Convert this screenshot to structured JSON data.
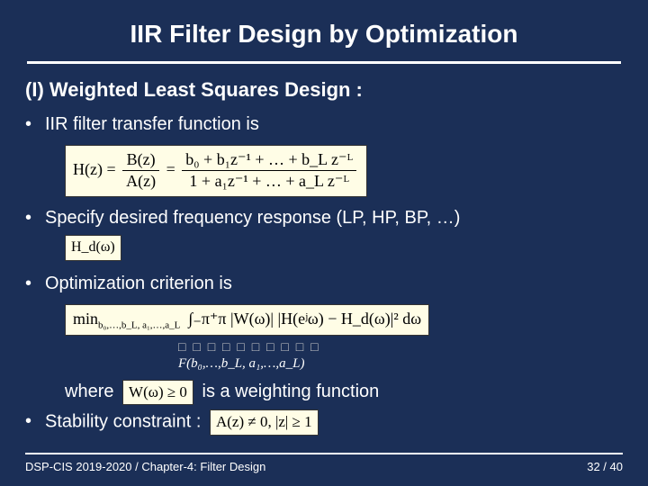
{
  "slide": {
    "title": "IIR Filter Design by Optimization",
    "subtitle": "(I)  Weighted Least Squares Design :",
    "bullets": {
      "b1": "IIR filter transfer function is",
      "b2": "Specify desired frequency response (LP, HP, BP, …)",
      "b3": "Optimization criterion is",
      "b4": "Stability constraint  :"
    },
    "formulas": {
      "hz_lhs": "H(z) =",
      "hz_frac1_num": "B(z)",
      "hz_frac1_den": "A(z)",
      "hz_eq": " = ",
      "hz_frac2_num": "b₀ + b₁z⁻¹ + … + b_L z⁻ᴸ",
      "hz_frac2_den": "1 + a₁z⁻¹ + … + a_L z⁻ᴸ",
      "hd": "H_d(ω)",
      "min_prefix": "min",
      "min_sub": "b₀,…,b_L, a₁,…,a_L",
      "min_int": "∫₋π⁺π |W(ω)| |H(eʲω) − H_d(ω)|² dω",
      "empty_boxes": "□ □ □ □ □ □ □ □ □ □",
      "f_label": "F(b₀,…,b_L, a₁,…,a_L)",
      "where_pre": "where",
      "wgeq": "W(ω) ≥ 0",
      "where_post": "is a weighting function",
      "stab": "A(z) ≠ 0, |z| ≥ 1"
    },
    "footer": {
      "left": "DSP-CIS 2019-2020 /  Chapter-4: Filter Design",
      "right": "32 / 40"
    }
  }
}
